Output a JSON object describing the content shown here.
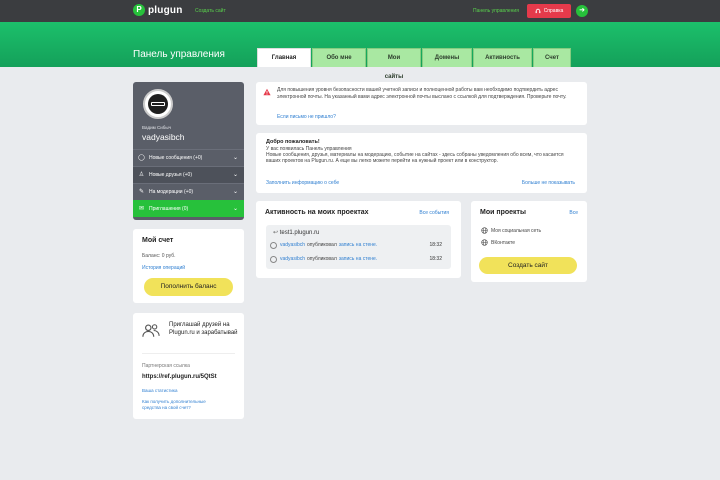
{
  "topbar": {
    "logo_mark": "P",
    "logo_text": "plugun",
    "create_site_link": "Создать сайт",
    "panel_link": "Панель управления",
    "help_button": "Справка",
    "logout_glyph": "➜"
  },
  "header": {
    "title": "Панель управления",
    "tabs": [
      {
        "label": "Главная",
        "active": true
      },
      {
        "label": "Обо мне"
      },
      {
        "label": "Мои сайты"
      },
      {
        "label": "Домены"
      },
      {
        "label": "Активность"
      },
      {
        "label": "Счет"
      }
    ]
  },
  "profile": {
    "fullname": "Вадим Сибыч",
    "username": "vadyasibch",
    "menu": [
      {
        "label": "Новые сообщения (+0)",
        "icon": "💬"
      },
      {
        "label": "Новые друзья (+0)",
        "icon": "👤"
      },
      {
        "label": "На модерации (+0)",
        "icon": "✎"
      },
      {
        "label": "Приглашения (0)",
        "icon": "✉"
      }
    ]
  },
  "balance": {
    "title": "Мой счет",
    "value": "Баланс: 0 руб.",
    "history_link": "История операций",
    "topup_button": "Пополнить баланс"
  },
  "invite": {
    "text": "Приглашай друзей на Plugun.ru и зарабатывай",
    "ref_label": "Партнерская ссылка",
    "ref_link": "https://ref.plugun.ru/5QtSt",
    "stats_link": "Ваша статистика",
    "earn_link": "Как получить дополнительные средства на свой счет?"
  },
  "alert": {
    "text": "Для повышения уровня безопасности вашей учетной записи и полноценной работы вам необходимо подтвердить адрес электронной почты. На указанный вами адрес электронной почты выслано с ссылкой для подтверждения. Проверьте почту.",
    "link": "Если письмо не пришло?"
  },
  "welcome": {
    "title": "Добро пожаловать!",
    "text": "У вас появилась Панель управления\nНовые сообщения, друзья, материалы на модерацию, событие на сайтах - здесь собраны уведомления обо всем, что касается ваших проектов на Plugun.ru. А еще вы легко можете перейти на нужный проект или в конструктор.",
    "fill_info_link": "Заполнить информацию о себе",
    "hide_link": "Больше не показывать"
  },
  "activity": {
    "title": "Активность на моих проектах",
    "all_events": "Все события",
    "site": "test1.plugun.ru",
    "events": [
      {
        "user": "vadyasibch",
        "verb": "опубликовал",
        "object": "запись на стене.",
        "time": "18:32"
      },
      {
        "user": "vadyasibch",
        "verb": "опубликовал",
        "object": "запись на стене.",
        "time": "18:32"
      }
    ]
  },
  "projects": {
    "title": "Мои проекты",
    "all_link": "Все",
    "items": [
      {
        "label": "Моя социальная сеть"
      },
      {
        "label": "ВКонтакте"
      }
    ],
    "create_button": "Создать сайт"
  },
  "colors": {
    "brand_green": "#27c13b",
    "header_green": "#1cc06b",
    "help_red": "#e53a4b",
    "button_yellow": "#f1e25a",
    "link_blue": "#2f7fd1",
    "sidebar_gray": "#5a5e68"
  },
  "icons": [
    "logo-icon",
    "headset-icon",
    "logout-icon",
    "chat-icon",
    "user-plus-icon",
    "pencil-icon",
    "mail-icon",
    "chevron-down-icon",
    "people-icon",
    "warning-icon",
    "share-icon",
    "user-icon",
    "globe-icon"
  ]
}
